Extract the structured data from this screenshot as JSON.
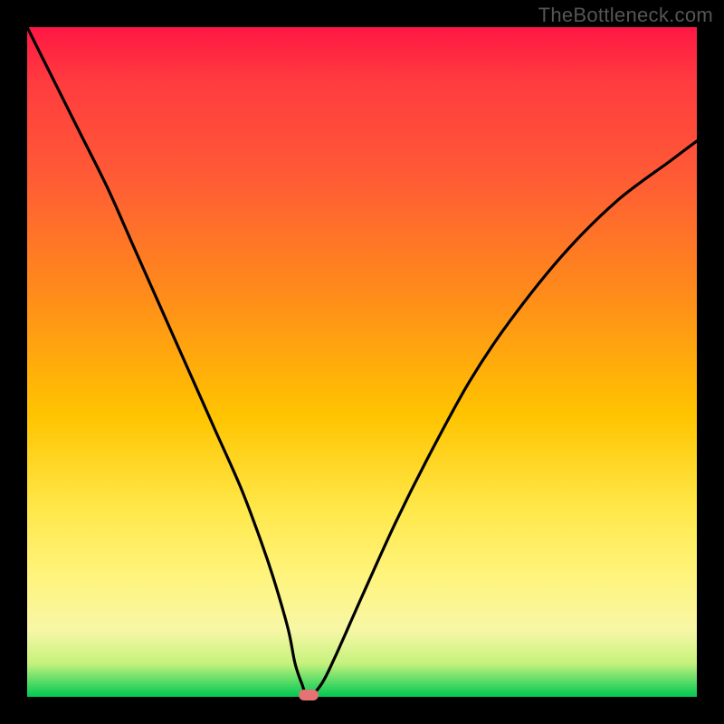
{
  "watermark": "TheBottleneck.com",
  "colors": {
    "background": "#000000",
    "curve": "#000000",
    "marker": "#e57373"
  },
  "chart_data": {
    "type": "line",
    "title": "",
    "xlabel": "",
    "ylabel": "",
    "xlim": [
      0,
      100
    ],
    "ylim": [
      0,
      100
    ],
    "grid": false,
    "legend": false,
    "annotations": [
      {
        "type": "marker",
        "x": 42,
        "y": 0,
        "shape": "pill",
        "color": "#e57373"
      }
    ],
    "series": [
      {
        "name": "bottleneck-curve",
        "x": [
          0,
          4,
          8,
          12,
          16,
          20,
          24,
          28,
          32,
          35,
          37,
          39,
          40,
          41,
          42,
          44,
          46,
          50,
          55,
          60,
          66,
          72,
          80,
          88,
          96,
          100
        ],
        "y": [
          100,
          92,
          84,
          76,
          67,
          58,
          49,
          40,
          31,
          23,
          17,
          10,
          5,
          2,
          0,
          2,
          6,
          15,
          26,
          36,
          47,
          56,
          66,
          74,
          80,
          83
        ]
      }
    ]
  }
}
